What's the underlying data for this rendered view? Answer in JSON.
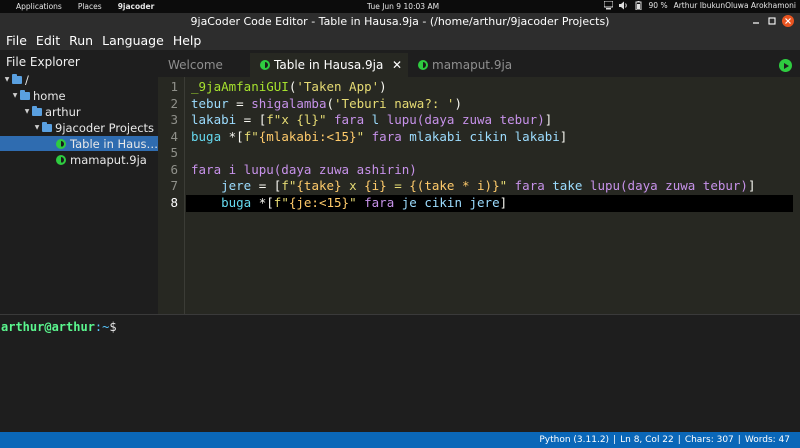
{
  "system_bar": {
    "applications": "Applications",
    "places": "Places",
    "app_name": "9jacoder",
    "clock": "Tue Jun 9  10:03 AM",
    "battery": "90 %",
    "user": "Arthur IbukunOluwa Arokhamoni"
  },
  "window": {
    "title": "9jaCoder Code Editor - Table in Hausa.9ja - (/home/arthur/9jacoder Projects)"
  },
  "menu": [
    "File",
    "Edit",
    "Run",
    "Language",
    "Help"
  ],
  "file_explorer": {
    "header": "File Explorer",
    "items": [
      {
        "label": "/",
        "type": "folder"
      },
      {
        "label": "home",
        "type": "folder"
      },
      {
        "label": "arthur",
        "type": "folder"
      },
      {
        "label": "9jacoder Projects",
        "type": "folder"
      },
      {
        "label": "Table in Haus…",
        "type": "file"
      },
      {
        "label": "mamaput.9ja",
        "type": "file"
      }
    ]
  },
  "tabs": [
    {
      "label": "Welcome",
      "active": false
    },
    {
      "label": "Table in Hausa.9ja",
      "active": true,
      "close": "✕"
    },
    {
      "label": "mamaput.9ja",
      "active": false
    }
  ],
  "editor": {
    "line_numbers": [
      "1",
      "2",
      "3",
      "4",
      "5",
      "6",
      "7",
      "8"
    ],
    "current_line": 8,
    "lines": [
      [
        {
          "t": "_9jaAmfaniGUI",
          "c": "fn"
        },
        {
          "t": "(",
          "c": "pl"
        },
        {
          "t": "'Taken App'",
          "c": "str"
        },
        {
          "t": ")",
          "c": "pl"
        }
      ],
      [
        {
          "t": "tebur",
          "c": "vr"
        },
        {
          "t": " = ",
          "c": "pl"
        },
        {
          "t": "shigalamba",
          "c": "lp"
        },
        {
          "t": "(",
          "c": "pl"
        },
        {
          "t": "'Teburi nawa?: '",
          "c": "str"
        },
        {
          "t": ")",
          "c": "pl"
        }
      ],
      [
        {
          "t": "lakabi",
          "c": "vr"
        },
        {
          "t": " = [",
          "c": "pl"
        },
        {
          "t": "f\"x {l}\"",
          "c": "str"
        },
        {
          "t": " fara ",
          "c": "lp"
        },
        {
          "t": "l",
          "c": "vr"
        },
        {
          "t": " lupu(daya zuwa tebur)",
          "c": "lp"
        },
        {
          "t": "]",
          "c": "pl"
        }
      ],
      [
        {
          "t": "buga",
          "c": "id"
        },
        {
          "t": " *[",
          "c": "pl"
        },
        {
          "t": "f\"",
          "c": "str"
        },
        {
          "t": "{mlakabi:<15}",
          "c": "fm"
        },
        {
          "t": "\"",
          "c": "str"
        },
        {
          "t": " fara ",
          "c": "lp"
        },
        {
          "t": "mlakabi cikin lakabi",
          "c": "vr"
        },
        {
          "t": "]",
          "c": "pl"
        }
      ],
      [],
      [
        {
          "t": "fara i lupu(daya zuwa ashirin)",
          "c": "lp"
        }
      ],
      [
        {
          "t": "    jere",
          "c": "vr"
        },
        {
          "t": " = [",
          "c": "pl"
        },
        {
          "t": "f\"",
          "c": "str"
        },
        {
          "t": "{take}",
          "c": "fm"
        },
        {
          "t": " x ",
          "c": "str"
        },
        {
          "t": "{i}",
          "c": "fm"
        },
        {
          "t": " = ",
          "c": "str"
        },
        {
          "t": "{(take * i)}",
          "c": "fm"
        },
        {
          "t": "\"",
          "c": "str"
        },
        {
          "t": " fara ",
          "c": "lp"
        },
        {
          "t": "take",
          "c": "vr"
        },
        {
          "t": " lupu(daya zuwa tebur)",
          "c": "lp"
        },
        {
          "t": "]",
          "c": "pl"
        }
      ],
      [
        {
          "t": "    buga",
          "c": "id"
        },
        {
          "t": " *[",
          "c": "pl"
        },
        {
          "t": "f\"",
          "c": "str"
        },
        {
          "t": "{je:<15}",
          "c": "fm"
        },
        {
          "t": "\"",
          "c": "str"
        },
        {
          "t": " fara ",
          "c": "lp"
        },
        {
          "t": "je cikin jere",
          "c": "vr"
        },
        {
          "t": "]",
          "c": "pl"
        }
      ]
    ]
  },
  "terminal": {
    "user": "arthur@arthur",
    "path": ":~",
    "sign": "$"
  },
  "status": {
    "language": "Python (3.11.2)",
    "sep": "|",
    "position": "Ln 8, Col 22",
    "chars": "Chars: 307",
    "words": "Words: 47"
  },
  "colors": {
    "accent": "#0a67b8",
    "editor_bg": "#272822",
    "selection": "#2f6cb0"
  }
}
